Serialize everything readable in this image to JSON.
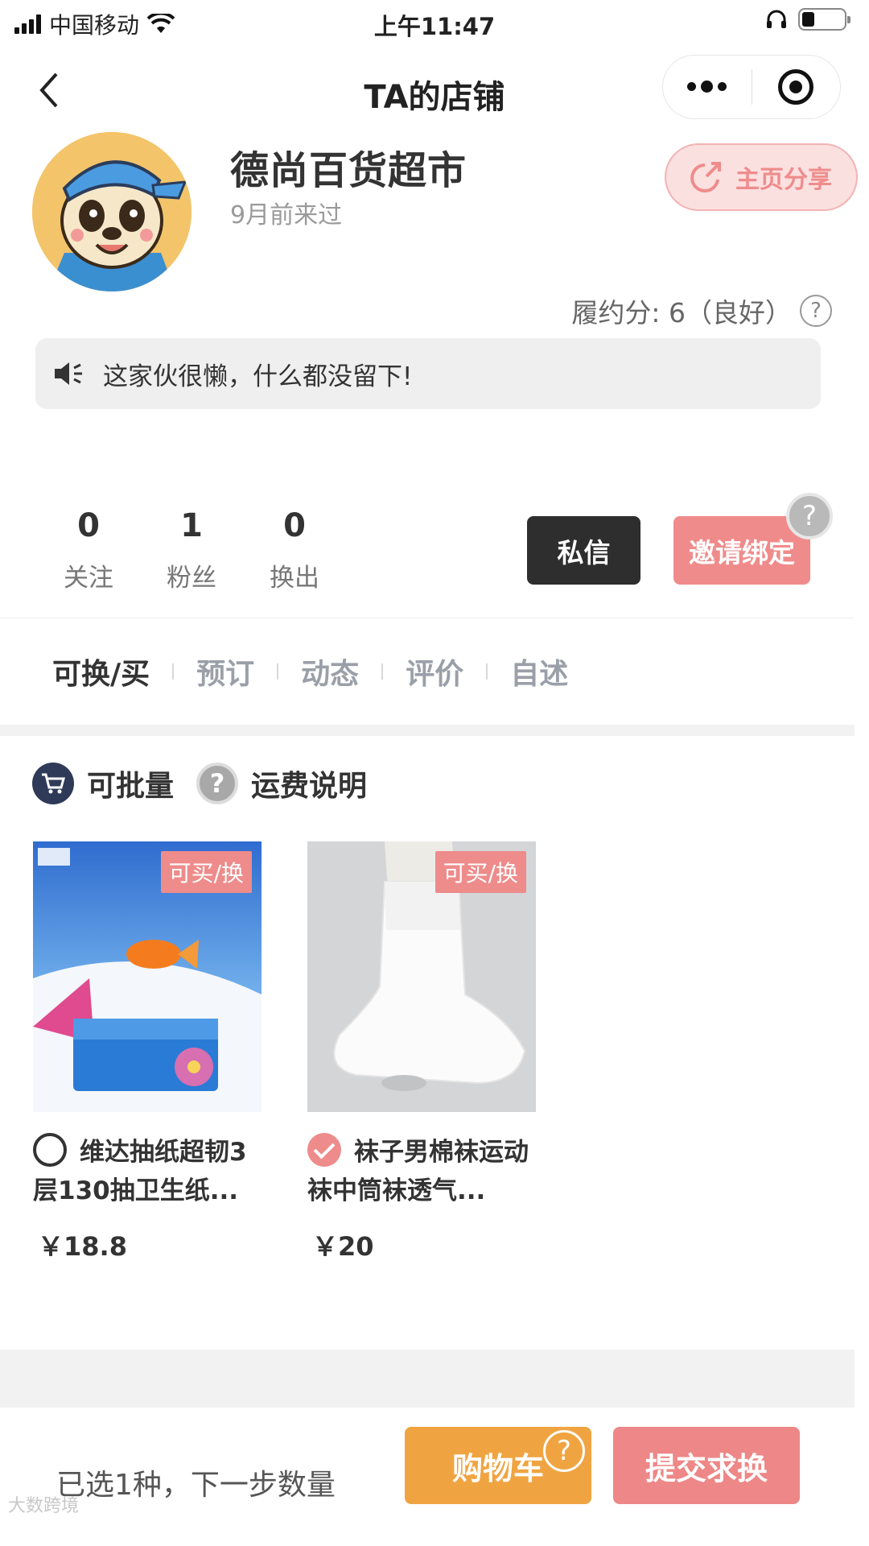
{
  "status_bar": {
    "carrier": "中国移动",
    "time": "上午11:47"
  },
  "nav": {
    "title": "TA的店铺"
  },
  "profile": {
    "shop_name": "德尚百货超市",
    "last_visit": "9月前来过",
    "share_label": "主页分享",
    "credit_text": "履约分: 6（良好）",
    "notice": "这家伙很懒，什么都没留下!"
  },
  "stats": [
    {
      "value": "0",
      "label": "关注"
    },
    {
      "value": "1",
      "label": "粉丝"
    },
    {
      "value": "0",
      "label": "换出"
    }
  ],
  "actions": {
    "message": "私信",
    "invite": "邀请绑定"
  },
  "tabs": [
    "可换/买",
    "预订",
    "动态",
    "评价",
    "自述"
  ],
  "filters": {
    "bulk": "可批量",
    "shipping": "运费说明"
  },
  "products": [
    {
      "tag": "可买/换",
      "title": "维达抽纸超韧3层130抽卫生纸...",
      "price": "￥18.8",
      "selected": false
    },
    {
      "tag": "可买/换",
      "title": "袜子男棉袜运动袜中筒袜透气...",
      "price": "￥20",
      "selected": true
    }
  ],
  "bottom": {
    "selected_info": "已选1种，下一步数量",
    "cart": "购物车",
    "submit": "提交求换"
  },
  "watermark": "大数跨境",
  "colors": {
    "accent_pink": "#ee8b8b",
    "cart_orange": "#f0a441",
    "dark_button": "#2e2e2e",
    "navy_icon": "#2f3a58"
  }
}
